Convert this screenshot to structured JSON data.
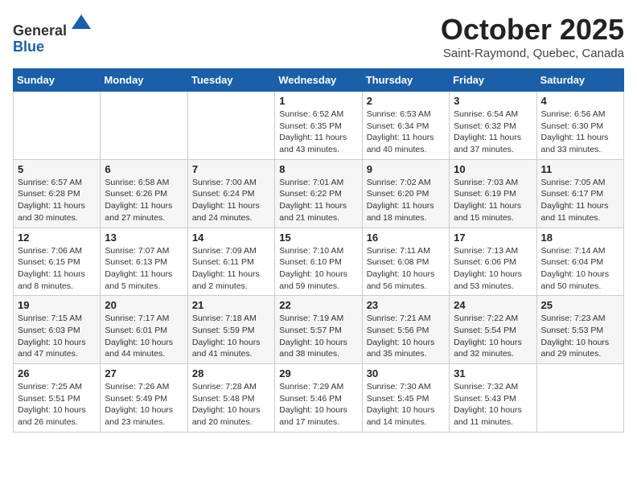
{
  "header": {
    "logo_line1": "General",
    "logo_line2": "Blue",
    "month": "October 2025",
    "location": "Saint-Raymond, Quebec, Canada"
  },
  "weekdays": [
    "Sunday",
    "Monday",
    "Tuesday",
    "Wednesday",
    "Thursday",
    "Friday",
    "Saturday"
  ],
  "weeks": [
    [
      {
        "day": "",
        "info": ""
      },
      {
        "day": "",
        "info": ""
      },
      {
        "day": "",
        "info": ""
      },
      {
        "day": "1",
        "info": "Sunrise: 6:52 AM\nSunset: 6:35 PM\nDaylight: 11 hours\nand 43 minutes."
      },
      {
        "day": "2",
        "info": "Sunrise: 6:53 AM\nSunset: 6:34 PM\nDaylight: 11 hours\nand 40 minutes."
      },
      {
        "day": "3",
        "info": "Sunrise: 6:54 AM\nSunset: 6:32 PM\nDaylight: 11 hours\nand 37 minutes."
      },
      {
        "day": "4",
        "info": "Sunrise: 6:56 AM\nSunset: 6:30 PM\nDaylight: 11 hours\nand 33 minutes."
      }
    ],
    [
      {
        "day": "5",
        "info": "Sunrise: 6:57 AM\nSunset: 6:28 PM\nDaylight: 11 hours\nand 30 minutes."
      },
      {
        "day": "6",
        "info": "Sunrise: 6:58 AM\nSunset: 6:26 PM\nDaylight: 11 hours\nand 27 minutes."
      },
      {
        "day": "7",
        "info": "Sunrise: 7:00 AM\nSunset: 6:24 PM\nDaylight: 11 hours\nand 24 minutes."
      },
      {
        "day": "8",
        "info": "Sunrise: 7:01 AM\nSunset: 6:22 PM\nDaylight: 11 hours\nand 21 minutes."
      },
      {
        "day": "9",
        "info": "Sunrise: 7:02 AM\nSunset: 6:20 PM\nDaylight: 11 hours\nand 18 minutes."
      },
      {
        "day": "10",
        "info": "Sunrise: 7:03 AM\nSunset: 6:19 PM\nDaylight: 11 hours\nand 15 minutes."
      },
      {
        "day": "11",
        "info": "Sunrise: 7:05 AM\nSunset: 6:17 PM\nDaylight: 11 hours\nand 11 minutes."
      }
    ],
    [
      {
        "day": "12",
        "info": "Sunrise: 7:06 AM\nSunset: 6:15 PM\nDaylight: 11 hours\nand 8 minutes."
      },
      {
        "day": "13",
        "info": "Sunrise: 7:07 AM\nSunset: 6:13 PM\nDaylight: 11 hours\nand 5 minutes."
      },
      {
        "day": "14",
        "info": "Sunrise: 7:09 AM\nSunset: 6:11 PM\nDaylight: 11 hours\nand 2 minutes."
      },
      {
        "day": "15",
        "info": "Sunrise: 7:10 AM\nSunset: 6:10 PM\nDaylight: 10 hours\nand 59 minutes."
      },
      {
        "day": "16",
        "info": "Sunrise: 7:11 AM\nSunset: 6:08 PM\nDaylight: 10 hours\nand 56 minutes."
      },
      {
        "day": "17",
        "info": "Sunrise: 7:13 AM\nSunset: 6:06 PM\nDaylight: 10 hours\nand 53 minutes."
      },
      {
        "day": "18",
        "info": "Sunrise: 7:14 AM\nSunset: 6:04 PM\nDaylight: 10 hours\nand 50 minutes."
      }
    ],
    [
      {
        "day": "19",
        "info": "Sunrise: 7:15 AM\nSunset: 6:03 PM\nDaylight: 10 hours\nand 47 minutes."
      },
      {
        "day": "20",
        "info": "Sunrise: 7:17 AM\nSunset: 6:01 PM\nDaylight: 10 hours\nand 44 minutes."
      },
      {
        "day": "21",
        "info": "Sunrise: 7:18 AM\nSunset: 5:59 PM\nDaylight: 10 hours\nand 41 minutes."
      },
      {
        "day": "22",
        "info": "Sunrise: 7:19 AM\nSunset: 5:57 PM\nDaylight: 10 hours\nand 38 minutes."
      },
      {
        "day": "23",
        "info": "Sunrise: 7:21 AM\nSunset: 5:56 PM\nDaylight: 10 hours\nand 35 minutes."
      },
      {
        "day": "24",
        "info": "Sunrise: 7:22 AM\nSunset: 5:54 PM\nDaylight: 10 hours\nand 32 minutes."
      },
      {
        "day": "25",
        "info": "Sunrise: 7:23 AM\nSunset: 5:53 PM\nDaylight: 10 hours\nand 29 minutes."
      }
    ],
    [
      {
        "day": "26",
        "info": "Sunrise: 7:25 AM\nSunset: 5:51 PM\nDaylight: 10 hours\nand 26 minutes."
      },
      {
        "day": "27",
        "info": "Sunrise: 7:26 AM\nSunset: 5:49 PM\nDaylight: 10 hours\nand 23 minutes."
      },
      {
        "day": "28",
        "info": "Sunrise: 7:28 AM\nSunset: 5:48 PM\nDaylight: 10 hours\nand 20 minutes."
      },
      {
        "day": "29",
        "info": "Sunrise: 7:29 AM\nSunset: 5:46 PM\nDaylight: 10 hours\nand 17 minutes."
      },
      {
        "day": "30",
        "info": "Sunrise: 7:30 AM\nSunset: 5:45 PM\nDaylight: 10 hours\nand 14 minutes."
      },
      {
        "day": "31",
        "info": "Sunrise: 7:32 AM\nSunset: 5:43 PM\nDaylight: 10 hours\nand 11 minutes."
      },
      {
        "day": "",
        "info": ""
      }
    ]
  ]
}
